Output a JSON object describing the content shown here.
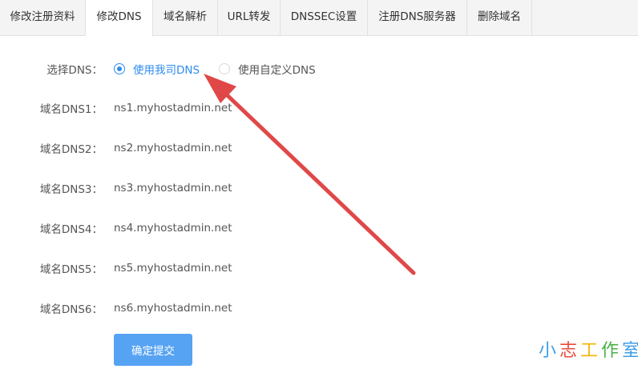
{
  "tabs": [
    {
      "label": "修改注册资料",
      "active": false
    },
    {
      "label": "修改DNS",
      "active": true
    },
    {
      "label": "域名解析",
      "active": false
    },
    {
      "label": "URL转发",
      "active": false
    },
    {
      "label": "DNSSEC设置",
      "active": false
    },
    {
      "label": "注册DNS服务器",
      "active": false
    },
    {
      "label": "删除域名",
      "active": false
    }
  ],
  "dns_select": {
    "label": "选择DNS：",
    "options": [
      {
        "label": "使用我司DNS",
        "checked": true
      },
      {
        "label": "使用自定义DNS",
        "checked": false
      }
    ]
  },
  "dns_servers": [
    {
      "label": "域名DNS1：",
      "value": "ns1.myhostadmin.net"
    },
    {
      "label": "域名DNS2：",
      "value": "ns2.myhostadmin.net"
    },
    {
      "label": "域名DNS3：",
      "value": "ns3.myhostadmin.net"
    },
    {
      "label": "域名DNS4：",
      "value": "ns4.myhostadmin.net"
    },
    {
      "label": "域名DNS5：",
      "value": "ns5.myhostadmin.net"
    },
    {
      "label": "域名DNS6：",
      "value": "ns6.myhostadmin.net"
    }
  ],
  "submit_label": "确定提交",
  "watermark": {
    "chars": [
      "小",
      "志",
      "工",
      "作",
      "室"
    ],
    "colors": [
      "#3d9ee8",
      "#e84d3d",
      "#f5b400",
      "#49b04a",
      "#3d9ee8"
    ]
  },
  "colors": {
    "accent": "#2d8cf0",
    "button": "#57a3f3",
    "arrow": "#e04848"
  }
}
